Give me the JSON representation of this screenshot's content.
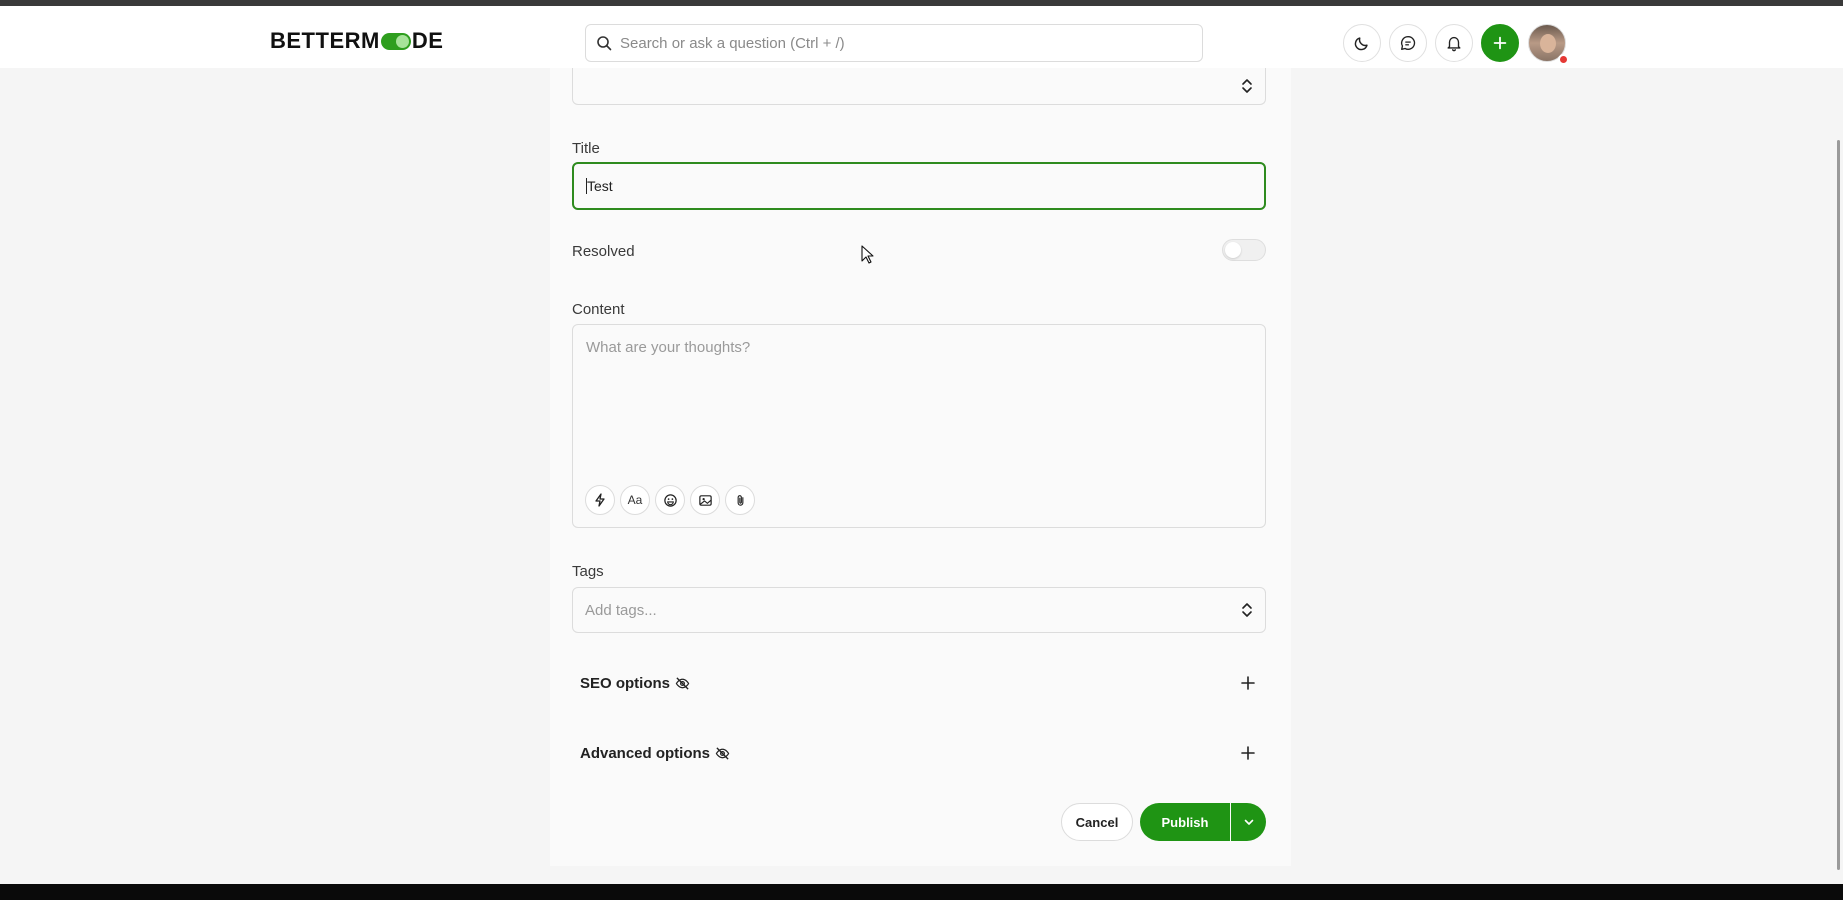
{
  "brand": {
    "logo_pre": "BETTERM",
    "logo_post": "DE",
    "accent": "#1f9414"
  },
  "header": {
    "search_placeholder": "Search or ask a question (Ctrl + /)",
    "icons": [
      "moon-icon",
      "chat-icon",
      "bell-icon",
      "plus-icon",
      "avatar"
    ]
  },
  "form": {
    "title": {
      "label": "Title",
      "value": "Test"
    },
    "resolved": {
      "label": "Resolved",
      "on": false
    },
    "content": {
      "label": "Content",
      "placeholder": "What are your thoughts?"
    },
    "toolbar": [
      "lightning-icon",
      "text-format-icon",
      "emoji-icon",
      "image-icon",
      "attachment-icon"
    ],
    "text_format_glyph": "Aa",
    "tags": {
      "label": "Tags",
      "placeholder": "Add tags..."
    },
    "seo": {
      "label": "SEO options"
    },
    "advanced": {
      "label": "Advanced options"
    }
  },
  "actions": {
    "cancel": "Cancel",
    "publish": "Publish"
  }
}
